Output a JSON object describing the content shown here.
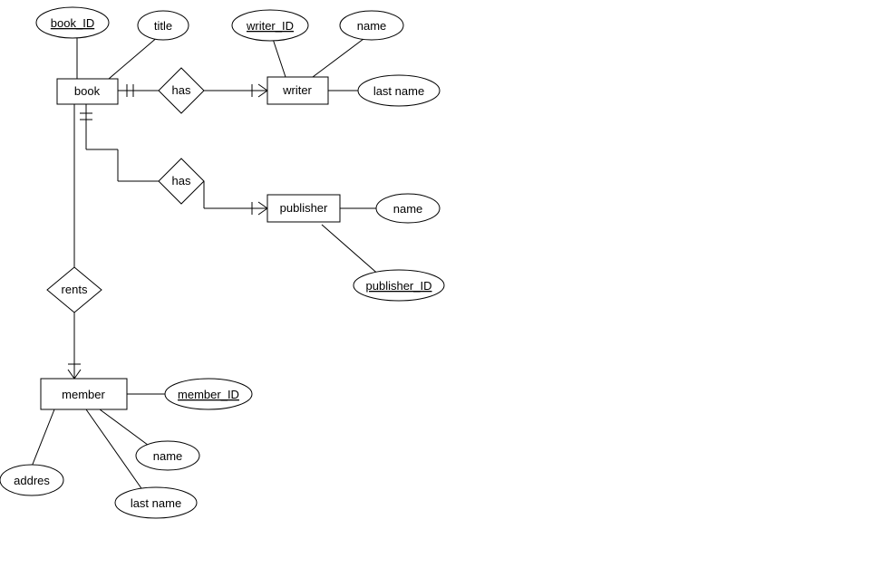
{
  "entities": {
    "book": {
      "label": "book"
    },
    "writer": {
      "label": "writer"
    },
    "publisher": {
      "label": "publisher"
    },
    "member": {
      "label": "member"
    }
  },
  "relationships": {
    "has_book_writer": {
      "label": "has"
    },
    "has_book_publisher": {
      "label": "has"
    },
    "rents": {
      "label": "rents"
    }
  },
  "attributes": {
    "book_id": {
      "label": "book_ID"
    },
    "title": {
      "label": "title"
    },
    "writer_id": {
      "label": "writer_ID"
    },
    "writer_name": {
      "label": "name"
    },
    "writer_lastname": {
      "label": "last name"
    },
    "publisher_name": {
      "label": "name"
    },
    "publisher_id": {
      "label": "publisher_ID"
    },
    "member_id": {
      "label": "member_ID"
    },
    "member_name": {
      "label": "name"
    },
    "member_lastname": {
      "label": "last name"
    },
    "member_address": {
      "label": "addres"
    }
  }
}
